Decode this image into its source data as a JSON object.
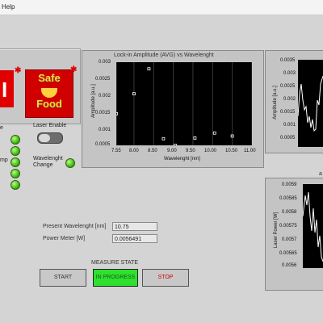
{
  "menu": {
    "help": "Help"
  },
  "controls": {
    "laser_enable_label": "Laser Enable",
    "wavelength_change_label": "Wavelenght Change",
    "left_cut_labels": [
      "e",
      "mp"
    ],
    "status_led_color": "#27b400"
  },
  "logos": {
    "left_red_letter": "I",
    "safe_food_line1": "Safe",
    "safe_food_line2": "Food"
  },
  "graphs": {
    "main": {
      "title": "Lock-in Amplitude (AVG) vs Wavelenght",
      "x_label": "Wavelenght [nm]",
      "y_label": "Amplitude [a.u.]",
      "y_ticks": [
        "0.003",
        "0.0025",
        "0.002",
        "0.0015",
        "0.001",
        "0.0005"
      ],
      "x_ticks": [
        "7.55",
        "8.00",
        "8.50",
        "9.00",
        "9.50",
        "10.00",
        "10.50",
        "11.00"
      ]
    },
    "right_top": {
      "y_label": "Amplitude [a.u.]",
      "y_ticks": [
        "0.0035",
        "0.003",
        "0.0025",
        "0.002",
        "0.0015",
        "0.001",
        "0.0005"
      ]
    },
    "right_bottom": {
      "cut_title": "a",
      "y_label": "Laser Power [W]",
      "y_ticks": [
        "0.0059",
        "0.00585",
        "0.0058",
        "0.00575",
        "0.0057",
        "0.00565",
        "0.0056"
      ]
    }
  },
  "chart_data": {
    "type": "scatter",
    "title": "Lock-in Amplitude (AVG) vs Wavelenght",
    "xlabel": "Wavelenght [nm]",
    "ylabel": "Amplitude [a.u.]",
    "xlim": [
      7.55,
      11.0
    ],
    "ylim": [
      0.0005,
      0.003
    ],
    "x": [
      7.55,
      8.0,
      8.38,
      8.75,
      9.05,
      9.55,
      10.05,
      10.5
    ],
    "y": [
      0.00145,
      0.00205,
      0.0028,
      0.0007,
      0.0005,
      0.00072,
      0.00087,
      0.00078
    ]
  },
  "readouts": {
    "present_wavelength_label": "Present Wavelenght [nm]",
    "present_wavelength_value": "10.75",
    "power_meter_label": "Power Meter [W]",
    "power_meter_value": "0.0056491"
  },
  "measure": {
    "label": "MEASURE STATE",
    "start": "START",
    "in_progress": "IN PROGRESS",
    "stop": "STOP"
  }
}
